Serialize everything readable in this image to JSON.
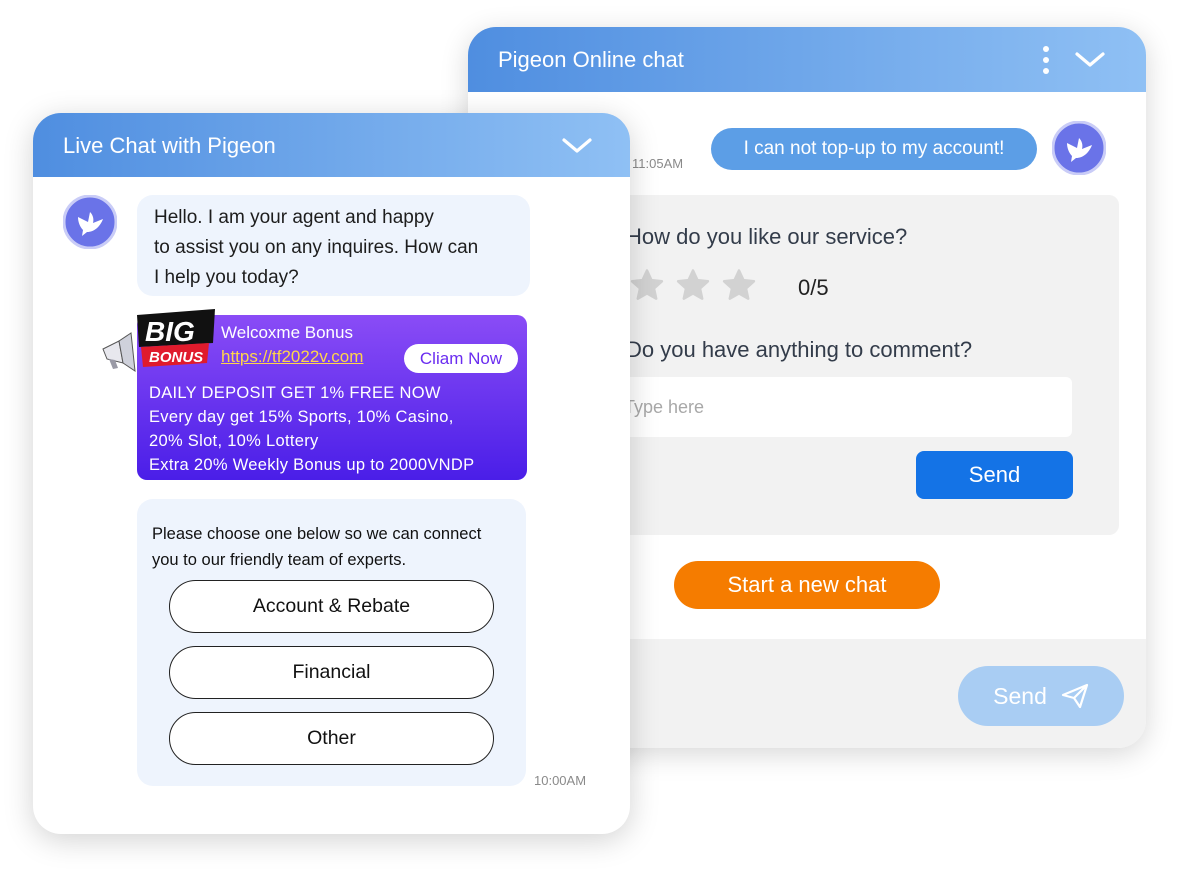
{
  "back_window": {
    "title": "Pigeon Online chat",
    "message_time": "11:05AM",
    "user_message": "I can not top-up to my account!",
    "rating": {
      "question": "How do you like our service?",
      "score_text": "0/5",
      "stars": 5,
      "filled": 0,
      "comment_question": "Do you have anything to comment?",
      "comment_placeholder": "Type here",
      "send_label": "Send"
    },
    "new_chat_label": "Start a new chat",
    "footer_send_label": "Send"
  },
  "front_window": {
    "title": "Live Chat with Pigeon",
    "agent_message_lines": [
      "Hello. I am your agent and happy",
      "to assist you on any inquires. How can",
      "I help you today?"
    ],
    "promo": {
      "badge_top": "BIG",
      "badge_bottom": "BONUS",
      "title": "Welcoxme Bonus",
      "link": "https://tf2022v.com",
      "claim_label": "Cliam Now",
      "lines": [
        "DAILY DEPOSIT GET 1% FREE NOW",
        "Every day get 15% Sports, 10% Casino,",
        "20% Slot, 10% Lottery",
        "Extra 20% Weekly Bonus up to 2000VNDP"
      ]
    },
    "options": {
      "prompt_lines": [
        "Please choose one below so we can connect",
        "you to our friendly team of experts."
      ],
      "buttons": [
        "Account & Rebate",
        "Financial",
        "Other"
      ]
    },
    "message_time": "10:00AM"
  },
  "colors": {
    "header_gradient_start": "#4f8ee0",
    "header_gradient_end": "#8fc0f4",
    "accent_blue": "#1473e6",
    "orange": "#f57c00",
    "promo_purple": "#6a2cf0",
    "bubble_bg": "#eef4fd"
  }
}
